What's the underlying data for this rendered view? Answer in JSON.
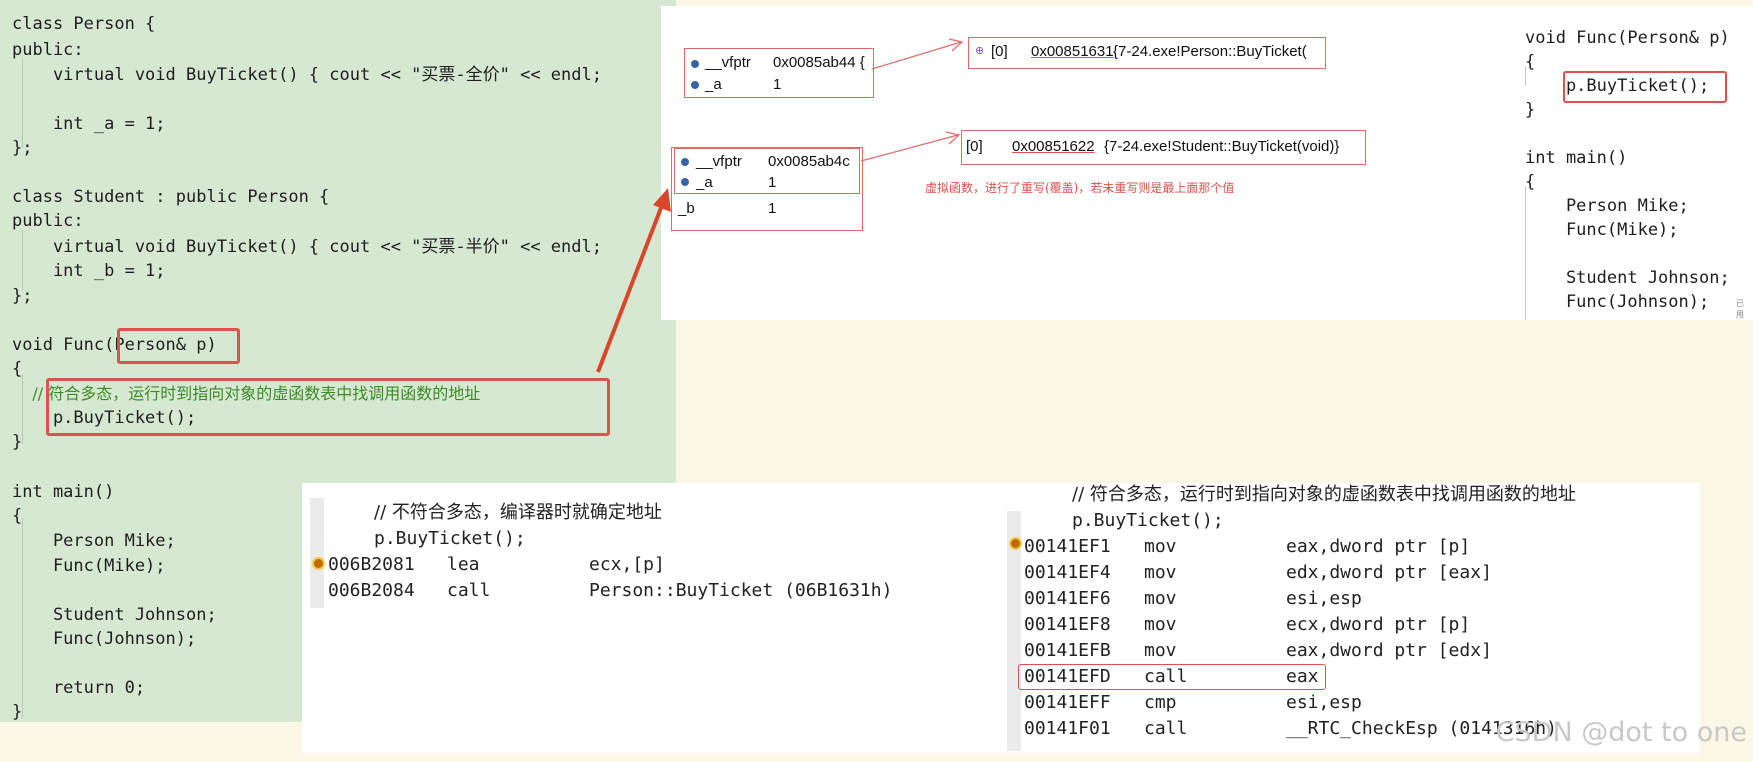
{
  "left_code": {
    "lines": [
      "class Person {",
      "public:",
      "    virtual void BuyTicket() { cout << \"买票-全价\" << endl;",
      "",
      "    int _a = 1;",
      "};",
      "",
      "class Student : public Person {",
      "public:",
      "    virtual void BuyTicket() { cout << \"买票-半价\" << endl;",
      "    int _b = 1;",
      "};",
      "",
      "void Func(Person& p)",
      "{",
      "    // 符合多态，运行时到指向对象的虚函数表中找调用函数的地址",
      "    p.BuyTicket();",
      "}",
      "",
      "int main()",
      "{",
      "    Person Mike;",
      "    Func(Mike);",
      "",
      "    Student Johnson;",
      "    Func(Johnson);",
      "",
      "    return 0;",
      "}"
    ]
  },
  "debug": {
    "person_vfptr_label": "__vfptr",
    "person_vfptr_value": "0x0085ab44 {",
    "person_a_label": "_a",
    "person_a_value": "1",
    "person_vtable_index": "[0]",
    "person_vtable_addr": "0x00851631",
    "person_vtable_desc": "{7-24.exe!Person::BuyTicket(",
    "student_vfptr_label": "__vfptr",
    "student_vfptr_value": "0x0085ab4c",
    "student_a_label": "_a",
    "student_a_value": "1",
    "student_b_label": "_b",
    "student_b_value": "1",
    "student_vtable_index": "[0]",
    "student_vtable_addr": "0x00851622",
    "student_vtable_desc": "{7-24.exe!Student::BuyTicket(void)}",
    "note": "虚拟函数，进行了重写(覆盖)，若未重写则是最上面那个值"
  },
  "right_code": {
    "lines": [
      "void Func(Person& p)",
      "{",
      "    p.BuyTicket();",
      "}",
      "",
      "int main()",
      "{",
      "    Person Mike;",
      "    Func(Mike);",
      "",
      "    Student Johnson;",
      "    Func(Johnson);"
    ],
    "tail_label": "已用"
  },
  "disasm_left": {
    "comment": "// 不符合多态，编译器时就确定地址",
    "call_line": "p.BuyTicket();",
    "rows": [
      {
        "addr": "006B2081",
        "op": "lea",
        "arg": "ecx,[p]"
      },
      {
        "addr": "006B2084",
        "op": "call",
        "arg": "Person::BuyTicket (06B1631h)"
      }
    ]
  },
  "disasm_right": {
    "comment": "// 符合多态，运行时到指向对象的虚函数表中找调用函数的地址",
    "call_line": "p.BuyTicket();",
    "rows": [
      {
        "addr": "00141EF1",
        "op": "mov",
        "arg": "eax,dword ptr [p]"
      },
      {
        "addr": "00141EF4",
        "op": "mov",
        "arg": "edx,dword ptr [eax]"
      },
      {
        "addr": "00141EF6",
        "op": "mov",
        "arg": "esi,esp"
      },
      {
        "addr": "00141EF8",
        "op": "mov",
        "arg": "ecx,dword ptr [p]"
      },
      {
        "addr": "00141EFB",
        "op": "mov",
        "arg": "eax,dword ptr [edx]"
      },
      {
        "addr": "00141EFD",
        "op": "call",
        "arg": "eax"
      },
      {
        "addr": "00141EFF",
        "op": "cmp",
        "arg": "esi,esp"
      },
      {
        "addr": "00141F01",
        "op": "call",
        "arg": "__RTC_CheckEsp (0141316h)"
      }
    ]
  },
  "watermark": "CSDN @dot to one",
  "colors": {
    "editor_bg": "#d6e8d2",
    "highlight": "#d9534f",
    "keyword": "#2b2bd6",
    "type": "#2b8aa8",
    "comment": "#3c8a28"
  }
}
